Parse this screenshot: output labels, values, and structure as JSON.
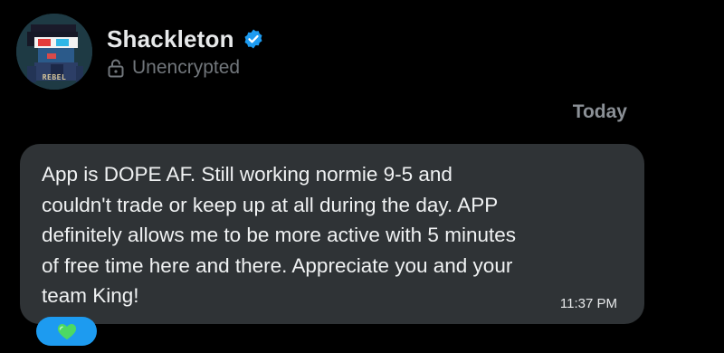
{
  "contact": {
    "name": "Shackleton",
    "verified_icon": "verified-badge-icon",
    "encryption_status": "Unencrypted",
    "avatar_text": "REBEL"
  },
  "conversation": {
    "date_separator": "Today",
    "messages": [
      {
        "text": "App is DOPE AF. Still working normie 9-5 and\ncouldn't trade or keep up at all during the day. APP\ndefinitely allows me to be more active with 5 minutes\nof free time here and there. Appreciate you and your\nteam King!",
        "time": "11:37 PM",
        "reaction": "💚"
      }
    ]
  },
  "colors": {
    "background": "#000000",
    "bubble": "#2f3336",
    "accent": "#1d9bf0",
    "secondary_text": "#71767b",
    "reaction_heart": "#4cd964"
  }
}
